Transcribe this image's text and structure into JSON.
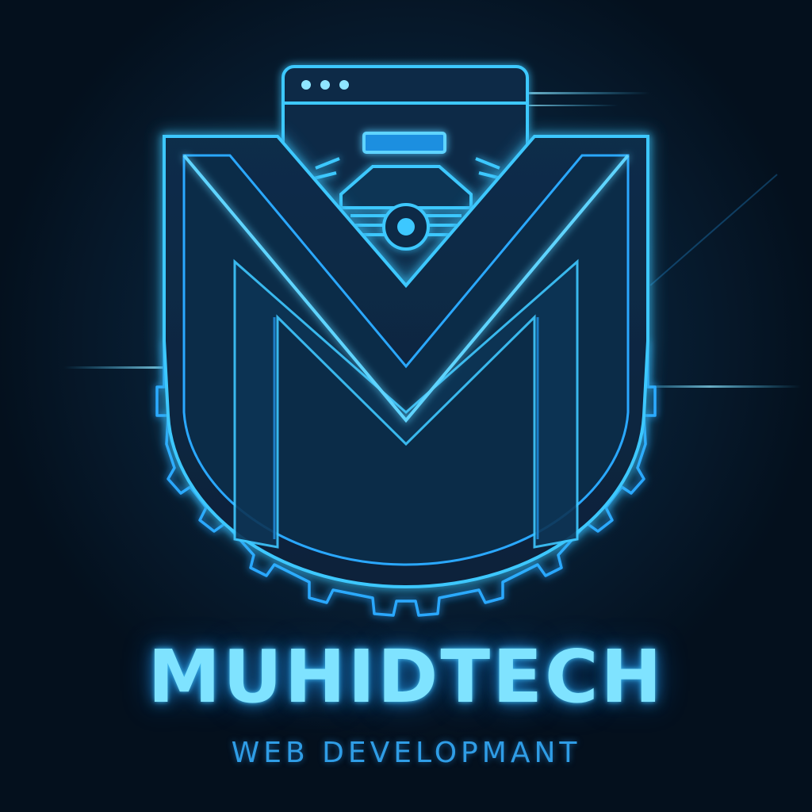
{
  "logo": {
    "brand_name": "MUHIDTECH",
    "tagline": "WEB DEVELOPMANT",
    "monogram_letter": "M",
    "icons": [
      "browser-window-icon",
      "gear-icon",
      "robot-head-icon"
    ]
  },
  "colors": {
    "background": "#071c30",
    "glow": "#3ec8ff",
    "outline": "#2aa8ff",
    "brand_text": "#7fe3ff",
    "tagline_text": "#2f9de6"
  }
}
